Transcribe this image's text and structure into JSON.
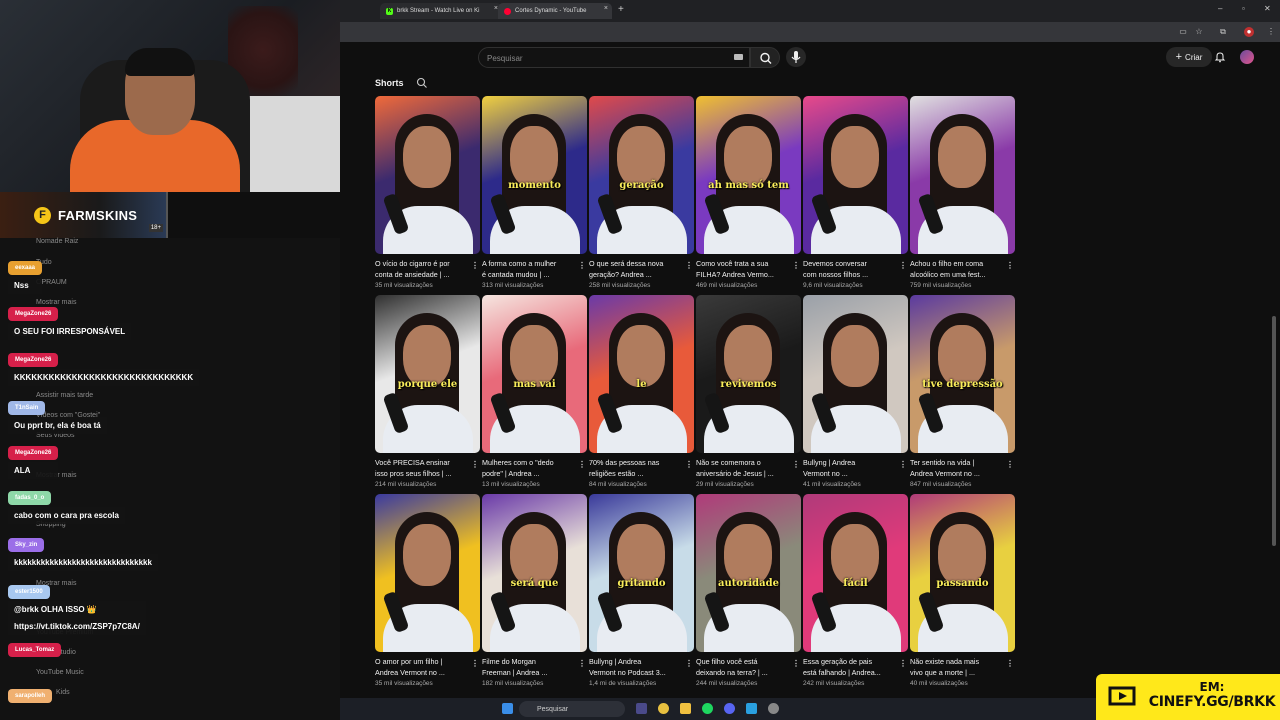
{
  "stream_overlay": {
    "sponsor": {
      "name": "FARMSKINS",
      "age_badge": "18+"
    },
    "ghost_sidebar": [
      "Nomade Raiz",
      "Tudo",
      "OPRAUM",
      "Mostrar mais",
      "Você",
      "Assistir mais tarde",
      "Vídeos com \"Gostei\"",
      "Seus vídeos",
      "Mostrar mais",
      "Shopping",
      "Mostrar mais",
      "YouTube Premium",
      "Studio",
      "YouTube Music",
      "Kids"
    ],
    "chat": [
      {
        "user": "eexaaa",
        "msg": "Nss",
        "color": "#e8a030"
      },
      {
        "user": "MegaZone26",
        "msg": "O SEU FOI IRRESPONSÁVEL",
        "color": "#d6204a"
      },
      {
        "user": "MegaZone26",
        "msg": "KKKKKKKKKKKKKKKKKKKKKKKKKKKKKKK",
        "color": "#d6204a"
      },
      {
        "user": "T1nSain",
        "msg": "Ou pprt br, ela é boa tá",
        "color": "#a0b8e8"
      },
      {
        "user": "MegaZone26",
        "msg": "ALA",
        "color": "#d6204a"
      },
      {
        "user": "fadas_0_o",
        "msg": "cabo com o cara pra escola",
        "color": "#8ed8a8"
      },
      {
        "user": "Sky_zin",
        "msg": "kkkkkkkkkkkkkkkkkkkkkkkkkkkkkkk",
        "color": "#9b6ee8"
      },
      {
        "user": "ester1500",
        "msg": "@brkk OLHA ISSO 👑",
        "msg2": "https://vt.tiktok.com/ZSP7p7C8A/",
        "color": "#a8c8f0"
      },
      {
        "user": "Lucas_Tomaz",
        "msg": "",
        "color": "#d6204a"
      },
      {
        "user": "sarapolleh",
        "msg": "",
        "color": "#f0b070"
      }
    ]
  },
  "browser": {
    "tabs": [
      {
        "label": "brkk Stream - Watch Live on Ki",
        "favicon_color": "#53fc18",
        "favicon_letter": "K"
      },
      {
        "label": "Cortes Dynamic - YouTube",
        "favicon_color": "#ff0033",
        "favicon_letter": ""
      }
    ]
  },
  "youtube": {
    "search_placeholder": "Pesquisar",
    "create_label": "Criar",
    "shorts_title": "Shorts",
    "shorts": [
      {
        "title_l1": "O vício do cigarro é por",
        "title_l2": "conta de ansiedade | ...",
        "views": "35 mil visualizações",
        "caption": "",
        "bg": "#3b2a6e",
        "accent": "#f06a3a"
      },
      {
        "title_l1": "A forma como a mulher",
        "title_l2": "é cantada mudou | ...",
        "views": "313 mil visualizações",
        "caption": "momento",
        "bg": "#2d2a8a",
        "accent": "#f0d040"
      },
      {
        "title_l1": "O que será dessa nova",
        "title_l2": "geração? Andrea ...",
        "views": "258 mil visualizações",
        "caption": "geração",
        "bg": "#3a3aa0",
        "accent": "#e04a4a"
      },
      {
        "title_l1": "Como você trata a sua",
        "title_l2": "FILHA? Andrea Vermo...",
        "views": "469 mil visualizações",
        "caption": "ah mas só tem",
        "bg": "#7a3ac0",
        "accent": "#f0c030"
      },
      {
        "title_l1": "Devemos conversar",
        "title_l2": "com nossos filhos ...",
        "views": "9,6 mil visualizações",
        "caption": "",
        "bg": "#5a2aa0",
        "accent": "#e84a8a"
      },
      {
        "title_l1": "Achou o filho em coma",
        "title_l2": "alcoólico em uma fest...",
        "views": "759 mil visualizações",
        "caption": "",
        "bg": "#8a3aa8",
        "accent": "#e0e0e0"
      },
      {
        "title_l1": "Você PRECISA ensinar",
        "title_l2": "isso pros seus filhos | ...",
        "views": "214 mil visualizações",
        "caption": "porque ele",
        "bg": "#e8e8e8",
        "accent": "#303030"
      },
      {
        "title_l1": "Mulheres com o \"dedo",
        "title_l2": "podre\" | Andrea ...",
        "views": "13 mil visualizações",
        "caption": "mas vai",
        "bg": "#e86a7a",
        "accent": "#f5e6e0"
      },
      {
        "title_l1": "70% das pessoas nas",
        "title_l2": "religiões estão ...",
        "views": "84 mil visualizações",
        "caption": "le",
        "bg": "#e85a3a",
        "accent": "#6a3aa8"
      },
      {
        "title_l1": "Não se comemora o",
        "title_l2": "aniversário de Jesus | ...",
        "views": "29 mil visualizações",
        "caption": "revivemos",
        "bg": "#1a1a1a",
        "accent": "#3a3a3a"
      },
      {
        "title_l1": "Bullyng | Andrea",
        "title_l2": "Vermont no ...",
        "views": "41 mil visualizações",
        "caption": "",
        "bg": "#d0c8c0",
        "accent": "#9aa0a8"
      },
      {
        "title_l1": "Ter sentido na vida |",
        "title_l2": "Andrea Vermont no ...",
        "views": "847 mil visualizações",
        "caption": "tive depressão",
        "bg": "#c89a6a",
        "accent": "#5a3aa0"
      },
      {
        "title_l1": "O amor por um filho |",
        "title_l2": "Andrea Vermont no ...",
        "views": "35 mil visualizações",
        "caption": "",
        "bg": "#f0c020",
        "accent": "#3a3aa0"
      },
      {
        "title_l1": "Filme do Morgan",
        "title_l2": "Freeman | Andrea ...",
        "views": "182 mil visualizações",
        "caption": "será que",
        "bg": "#e8e0d8",
        "accent": "#6a3aa8"
      },
      {
        "title_l1": "Bullyng | Andrea",
        "title_l2": "Vermont no Podcast 3...",
        "views": "1,4 mi de visualizações",
        "caption": "gritando",
        "bg": "#c8dce8",
        "accent": "#3a3a9a"
      },
      {
        "title_l1": "Que filho você está",
        "title_l2": "deixando na terra? | ...",
        "views": "244 mil visualizações",
        "caption": "autoridade",
        "bg": "#8a8a7a",
        "accent": "#b03a7a"
      },
      {
        "title_l1": "Essa geração de pais",
        "title_l2": "está falhando | Andrea...",
        "views": "242 mil visualizações",
        "caption": "fácil",
        "bg": "#e03a7a",
        "accent": "#b03a7a"
      },
      {
        "title_l1": "Não existe nada mais",
        "title_l2": "vivo que a morte | ...",
        "views": "40 mil visualizações",
        "caption": "passando",
        "bg": "#e8d040",
        "accent": "#b03a7a"
      }
    ]
  },
  "taskbar": {
    "search_label": "Pesquisar"
  },
  "promo": {
    "line1": "EM:",
    "line2": "CINEFY.GG/BRKK"
  }
}
